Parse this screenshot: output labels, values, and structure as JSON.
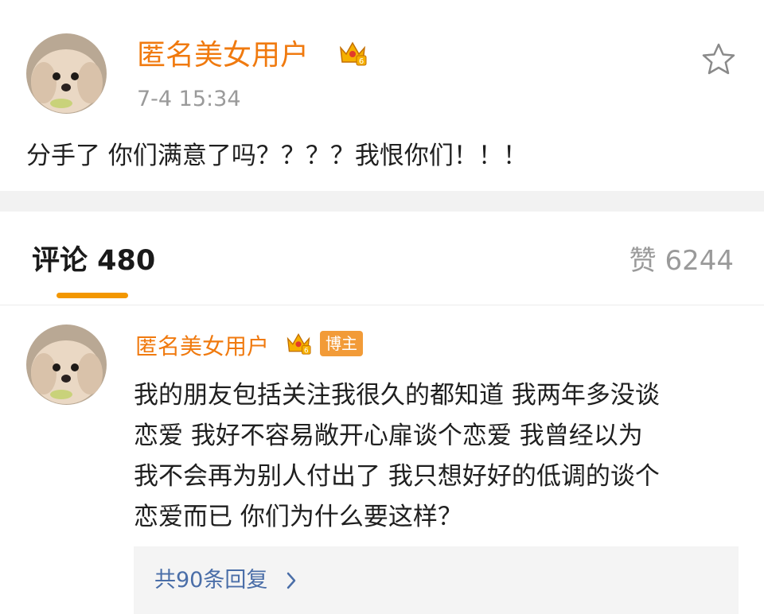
{
  "post": {
    "author": "匿名美女用户",
    "time": "7-4 15:34",
    "text": "分手了 你们满意了吗？？？？我恨你们！！！",
    "icons": {
      "avatar": "dog-avatar",
      "vip": "crown-icon",
      "favorite": "star-icon"
    }
  },
  "tabs": {
    "comments_label": "评论 480",
    "likes_label": "赞 6244"
  },
  "comment": {
    "author": "匿名美女用户",
    "badge": "博主",
    "lines": [
      "我的朋友包括关注我很久的都知道 我两年多没谈",
      "恋爱 我好不容易敞开心扉谈个恋爱 我曾经以为",
      "我不会再为别人付出了 我只想好好的低调的谈个",
      "恋爱而已 你们为什么要这样？"
    ],
    "replies_label": "共90条回复"
  },
  "colors": {
    "username": "#f07a0f",
    "accent": "#f39700",
    "badge": "#f29b38",
    "link": "#4a6ea8",
    "muted": "#9a9a9a"
  }
}
